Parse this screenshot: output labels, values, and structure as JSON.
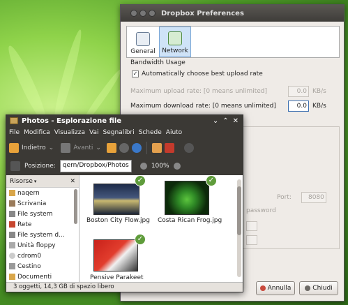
{
  "dropbox": {
    "title": "Dropbox Preferences",
    "tabs": [
      {
        "label": "General",
        "icon": "general-settings-icon"
      },
      {
        "label": "Network",
        "icon": "network-icon"
      }
    ],
    "bandwidth": {
      "heading": "Bandwidth Usage",
      "auto_label": "Automatically choose best upload rate",
      "auto_checked": true,
      "upload_label": "Maximum upload rate: [0 means unlimited]",
      "upload_value": "0.0",
      "download_label": "Maximum download rate: [0 means unlimited]",
      "download_value": "0.0",
      "unit": "KB/s"
    },
    "proxy": {
      "port_label": "Port:",
      "port_value": "8080",
      "password_label": "password"
    },
    "buttons": {
      "cancel": "Annulla",
      "close": "Chiudi"
    }
  },
  "filemanager": {
    "title": "Photos - Esplorazione file",
    "window_controls": [
      "⌄",
      "⌃",
      "✕"
    ],
    "menu": [
      "File",
      "Modifica",
      "Visualizza",
      "Vai",
      "Segnalibri",
      "Schede",
      "Aiuto"
    ],
    "toolbar": {
      "back": "Indietro",
      "forward": "Avanti"
    },
    "location_label": "Posizione:",
    "location_value": "qern/Dropbox/Photos",
    "zoom": "100%",
    "sidebar_title": "Risorse",
    "sidebar_items": [
      "naqern",
      "Scrivania",
      "File system",
      "Rete",
      "File system d...",
      "Unità floppy",
      "cdrom0",
      "Cestino",
      "Documenti"
    ],
    "files": [
      "Boston City Flow.jpg",
      "Costa Rican Frog.jpg",
      "Pensive Parakeet"
    ],
    "status": "3 oggetti, 14,3 GB di spazio libero"
  },
  "colors": {
    "sync_ok": "#5f9c3b",
    "titlebar": "#3b3935"
  }
}
